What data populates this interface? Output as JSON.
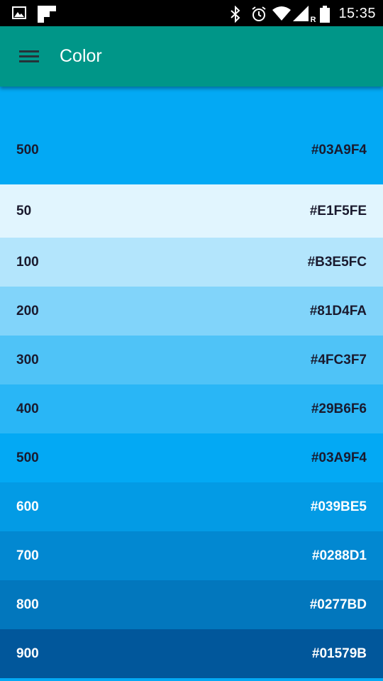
{
  "status_bar": {
    "time": "15:35",
    "icons": [
      "image-icon",
      "flipboard-icon",
      "bluetooth-icon",
      "alarm-icon",
      "wifi-icon",
      "signal-icon",
      "battery-icon"
    ],
    "roaming_label": "R"
  },
  "app_bar": {
    "title": "Color",
    "color": "#009688",
    "menu_icon": "hamburger-menu-icon"
  },
  "header": {
    "shade": "500",
    "hex": "#03A9F4",
    "bg": "#03A9F4",
    "text_color": "#1A1A2E"
  },
  "swatches": [
    {
      "shade": "50",
      "hex": "#E1F5FE",
      "bg": "#E1F5FE",
      "text_color": "#1A1A2E"
    },
    {
      "shade": "100",
      "hex": "#B3E5FC",
      "bg": "#B3E5FC",
      "text_color": "#1A1A2E"
    },
    {
      "shade": "200",
      "hex": "#81D4FA",
      "bg": "#81D4FA",
      "text_color": "#1A1A2E"
    },
    {
      "shade": "300",
      "hex": "#4FC3F7",
      "bg": "#4FC3F7",
      "text_color": "#1A1A2E"
    },
    {
      "shade": "400",
      "hex": "#29B6F6",
      "bg": "#29B6F6",
      "text_color": "#1A1A2E"
    },
    {
      "shade": "500",
      "hex": "#03A9F4",
      "bg": "#03A9F4",
      "text_color": "#1A1A2E"
    },
    {
      "shade": "600",
      "hex": "#039BE5",
      "bg": "#039BE5",
      "text_color": "#FFFFFF"
    },
    {
      "shade": "700",
      "hex": "#0288D1",
      "bg": "#0288D1",
      "text_color": "#FFFFFF"
    },
    {
      "shade": "800",
      "hex": "#0277BD",
      "bg": "#0277BD",
      "text_color": "#FFFFFF"
    },
    {
      "shade": "900",
      "hex": "#01579B",
      "bg": "#01579B",
      "text_color": "#FFFFFF"
    }
  ]
}
